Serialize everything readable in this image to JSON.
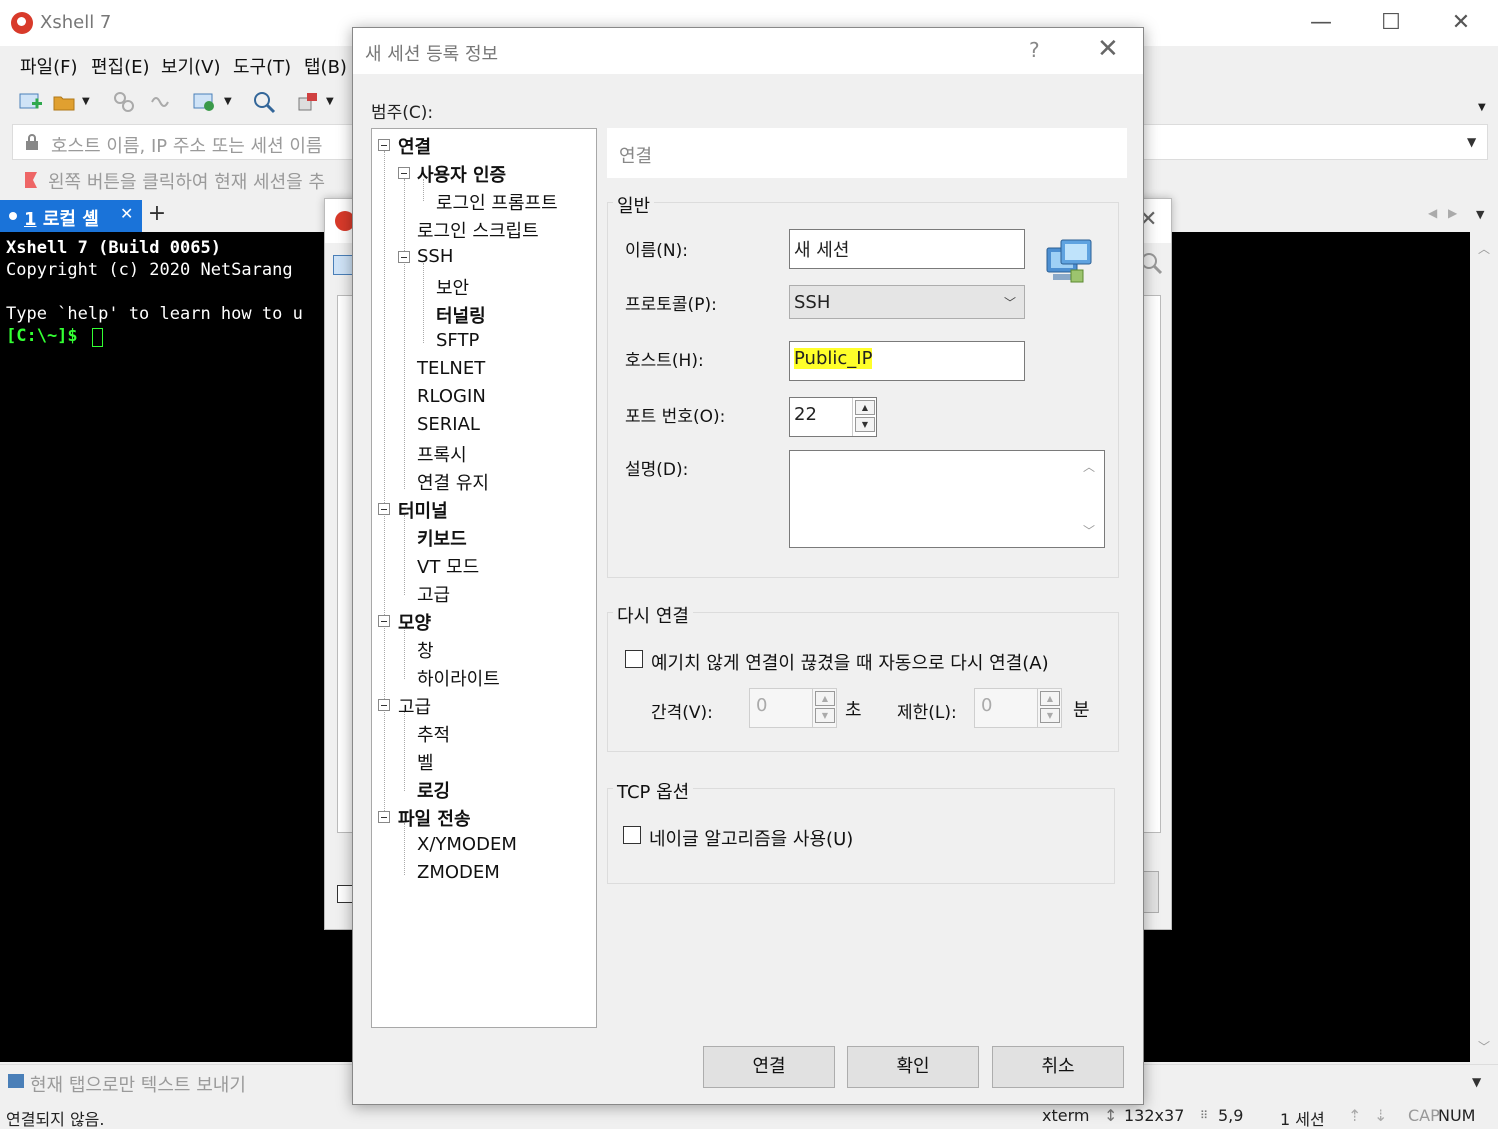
{
  "app": {
    "title": "Xshell 7"
  },
  "menu": [
    "파일(F)",
    "편집(E)",
    "보기(V)",
    "도구(T)",
    "탭(B)"
  ],
  "address_bar": {
    "placeholder": "호스트 이름, IP 주소 또는 세션 이름"
  },
  "hint_bar": {
    "text": "왼쪽 버튼을 클릭하여 현재 세션을 추"
  },
  "tab": {
    "number": "1",
    "label": "로컬 셸"
  },
  "terminal": {
    "lines": [
      "Xshell 7 (Build 0065)",
      "Copyright (c) 2020 NetSarang",
      "",
      "Type `help' to learn how to u",
      "[C:\\~]$ "
    ]
  },
  "sendbar": {
    "text": "현재 탭으로만 텍스트 보내기"
  },
  "status": {
    "connection": "연결되지 않음.",
    "terminal_type": "xterm",
    "size": "132x37",
    "cursor": "5,9",
    "sessions": "1 세션",
    "caps": "CAP",
    "num": "NUM"
  },
  "dialog": {
    "title": "새 세션 등록 정보",
    "help": "?",
    "category_label": "범주(C):",
    "tree": [
      {
        "label": "연결",
        "bold": true
      },
      {
        "label": "사용자 인증",
        "bold": true
      },
      {
        "label": "로그인 프롬프트",
        "bold": false
      },
      {
        "label": "로그인 스크립트",
        "bold": false
      },
      {
        "label": "SSH",
        "bold": false
      },
      {
        "label": "보안",
        "bold": false
      },
      {
        "label": "터널링",
        "bold": true
      },
      {
        "label": "SFTP",
        "bold": false
      },
      {
        "label": "TELNET",
        "bold": false
      },
      {
        "label": "RLOGIN",
        "bold": false
      },
      {
        "label": "SERIAL",
        "bold": false
      },
      {
        "label": "프록시",
        "bold": false
      },
      {
        "label": "연결 유지",
        "bold": false
      },
      {
        "label": "터미널",
        "bold": true
      },
      {
        "label": "키보드",
        "bold": true
      },
      {
        "label": "VT 모드",
        "bold": false
      },
      {
        "label": "고급",
        "bold": false
      },
      {
        "label": "모양",
        "bold": true
      },
      {
        "label": "창",
        "bold": false
      },
      {
        "label": "하이라이트",
        "bold": false
      },
      {
        "label": "고급",
        "bold": false
      },
      {
        "label": "추적",
        "bold": false
      },
      {
        "label": "벨",
        "bold": false
      },
      {
        "label": "로깅",
        "bold": true
      },
      {
        "label": "파일 전송",
        "bold": true
      },
      {
        "label": "X/YMODEM",
        "bold": false
      },
      {
        "label": "ZMODEM",
        "bold": false
      }
    ],
    "panel_header": "연결",
    "general": {
      "title": "일반",
      "name_label": "이름(N):",
      "name_value": "새 세션",
      "protocol_label": "프로토콜(P):",
      "protocol_value": "SSH",
      "host_label": "호스트(H):",
      "host_value": "Public_IP",
      "port_label": "포트 번호(O):",
      "port_value": "22",
      "desc_label": "설명(D):",
      "desc_value": ""
    },
    "reconnect": {
      "title": "다시 연결",
      "checkbox_label": "예기치 않게 연결이 끊겼을 때 자동으로 다시 연결(A)",
      "interval_label": "간격(V):",
      "interval_value": "0",
      "interval_unit": "초",
      "limit_label": "제한(L):",
      "limit_value": "0",
      "limit_unit": "분"
    },
    "tcp": {
      "title": "TCP 옵션",
      "checkbox_label": "네이글 알고리즘을 사용(U)"
    },
    "buttons": {
      "connect": "연결",
      "ok": "확인",
      "cancel": "취소"
    }
  },
  "colors": {
    "tab_active": "#1a73d9",
    "terminal_bg": "#000000",
    "prompt": "#33ff33",
    "highlight": "#ffff2a"
  }
}
